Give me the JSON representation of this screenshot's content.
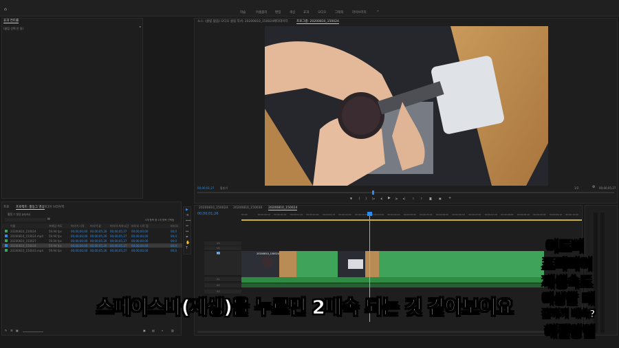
{
  "menu": {
    "items": [
      "학습",
      "어셈블리",
      "편집",
      "색상",
      "효과",
      "오디오",
      "그래픽",
      "라이브러리",
      "»"
    ]
  },
  "source_panel": {
    "tab_label": "효과 컨트롤",
    "clip_label": "(클립 선택 안 됨)"
  },
  "program_tabs": [
    "소스: (클립 없음)",
    "오디오 클립 믹서: 20200810_150024",
    "메타데이터",
    "프로그램: 20200810_150024"
  ],
  "program_monitor": {
    "timecode_left": "00;00;01;27",
    "fit_label": "맞추기",
    "quality_label": "1/2",
    "timecode_right": "00;00;05;27"
  },
  "project_panel": {
    "tabs": [
      "프로젝트: 활동그 영상",
      "미디어 브라우저"
    ],
    "project_file": "활동그 영상.prproj",
    "selection_info": "5개 항목 중 1개 항목 선택됨",
    "columns": [
      "이름",
      "프레임 속도",
      "미디어 시작",
      "미디어 끝",
      "미디어 지속시간",
      "비디오 시작 점",
      "비디오"
    ],
    "rows": [
      [
        "20200810_150024",
        "59.94 fps",
        "00;00;00;00",
        "00;00;05;26",
        "00;00;05;27",
        "00;00;00;00",
        "00;0"
      ],
      [
        "20200810_150024.mp4",
        "59.94 fps",
        "00;00;00;00",
        "00;00;05;26",
        "00;00;05;27",
        "00;00;00;00",
        "00;0"
      ],
      [
        "20200810_150027",
        "59.94 fps",
        "00;00;00;00",
        "00;00;05;26",
        "00;00;05;27",
        "00;00;00;00",
        "00;0"
      ],
      [
        "20200810_150034",
        "59.94 fps",
        "00;00;00;00",
        "00;00;05;26",
        "00;00;05;27",
        "00;00;00;00",
        "00;0"
      ],
      [
        "20200810_150043.mp4",
        "59.94 fps",
        "00;00;00;00",
        "00;00;05;26",
        "00;00;05;27",
        "00;00;00;00",
        "00;0"
      ]
    ]
  },
  "timeline": {
    "tabs": [
      "20200810_150024",
      "20200810_150030",
      "20200810_150024"
    ],
    "timecode": "00;00;01;26",
    "ruler_ticks": [
      "00;00",
      "00;00;00;16",
      "00;00;01;00",
      "00;00;01;16",
      "00;00;02;00",
      "00;00;02;16",
      "00;00;03;00",
      "00;00;03;16",
      "00;00;04;00",
      "00;00;04;16",
      "00;00;05;00",
      "00;00;05;16",
      "00;00;06;00",
      "00;00;06;16",
      "00;00;07;00",
      "00;00;07;16",
      "00;00;08;00",
      "00;00;08;16",
      "00;00;09;00",
      "00;00;09;16",
      "00;00;10;00"
    ],
    "video_tracks": [
      "V3",
      "V2",
      "V1"
    ],
    "audio_tracks": [
      "A1",
      "A2",
      "A3"
    ],
    "v1_clip_label": "20200810_150024"
  },
  "subtitle": "스페이스바(재생)을 누르면 2배속 되는 것 같아보여요",
  "title_overlay": {
    "lines": [
      "어도비",
      "프리미어",
      "재생속도",
      "이상할 때",
      "갑자기 배속?",
      "해결방법"
    ],
    "colors": [
      "#ffffff",
      "#b84dff",
      "#7cff3a",
      "#7cff3a",
      "#ffffff",
      "#ffffff"
    ]
  },
  "colors": {
    "accent_blue": "#2d8ceb",
    "clip_green": "#3fa35a",
    "background": "#1a1a1a"
  }
}
